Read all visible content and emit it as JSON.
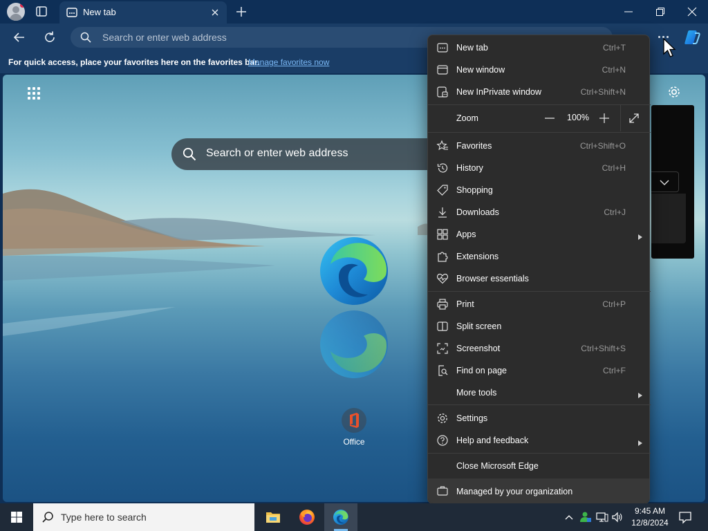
{
  "browser": {
    "tab_title": "New tab",
    "omnibox_placeholder": "Search or enter web address"
  },
  "favorites_bar": {
    "text": "For quick access, place your favorites here on the favorites bar.",
    "link": "Manage favorites now"
  },
  "page": {
    "search_placeholder": "Search or enter web address",
    "tiles": [
      {
        "label": "Office",
        "icon": "office-icon"
      }
    ]
  },
  "menu": {
    "items": [
      {
        "label": "New tab",
        "shortcut": "Ctrl+T",
        "icon": "new-tab-icon"
      },
      {
        "label": "New window",
        "shortcut": "Ctrl+N",
        "icon": "new-window-icon"
      },
      {
        "label": "New InPrivate window",
        "shortcut": "Ctrl+Shift+N",
        "icon": "inprivate-icon"
      }
    ],
    "zoom": {
      "label": "Zoom",
      "value": "100%"
    },
    "items2": [
      {
        "label": "Favorites",
        "shortcut": "Ctrl+Shift+O",
        "icon": "favorites-star-icon"
      },
      {
        "label": "History",
        "shortcut": "Ctrl+H",
        "icon": "history-icon"
      },
      {
        "label": "Shopping",
        "shortcut": "",
        "icon": "shopping-tag-icon"
      },
      {
        "label": "Downloads",
        "shortcut": "Ctrl+J",
        "icon": "download-icon"
      },
      {
        "label": "Apps",
        "shortcut": "",
        "icon": "apps-icon",
        "submenu": true
      },
      {
        "label": "Extensions",
        "shortcut": "",
        "icon": "extensions-puzzle-icon"
      },
      {
        "label": "Browser essentials",
        "shortcut": "",
        "icon": "heart-pulse-icon"
      }
    ],
    "items3": [
      {
        "label": "Print",
        "shortcut": "Ctrl+P",
        "icon": "print-icon"
      },
      {
        "label": "Split screen",
        "shortcut": "",
        "icon": "split-screen-icon"
      },
      {
        "label": "Screenshot",
        "shortcut": "Ctrl+Shift+S",
        "icon": "screenshot-icon"
      },
      {
        "label": "Find on page",
        "shortcut": "Ctrl+F",
        "icon": "find-icon"
      },
      {
        "label": "More tools",
        "shortcut": "",
        "icon": "",
        "submenu": true
      }
    ],
    "items4": [
      {
        "label": "Settings",
        "shortcut": "",
        "icon": "settings-gear-icon"
      },
      {
        "label": "Help and feedback",
        "shortcut": "",
        "icon": "help-icon",
        "submenu": true
      }
    ],
    "close_label": "Close Microsoft Edge",
    "managed_label": "Managed by your organization"
  },
  "taskbar": {
    "search_placeholder": "Type here to search",
    "time": "9:45 AM",
    "date": "12/8/2024"
  }
}
